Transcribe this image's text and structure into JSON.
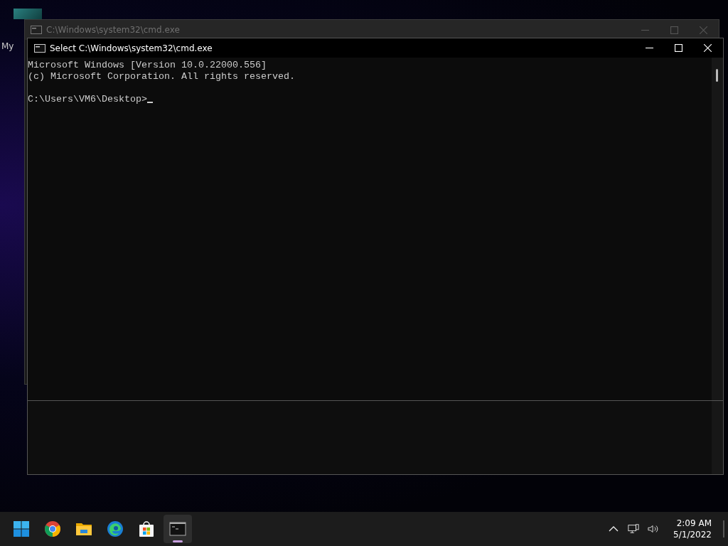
{
  "desktop": {
    "icon_label": "My"
  },
  "background_window": {
    "title": "C:\\Windows\\system32\\cmd.exe"
  },
  "window": {
    "title": "Select C:\\Windows\\system32\\cmd.exe",
    "output": [
      "Microsoft Windows [Version 10.0.22000.556]",
      "(c) Microsoft Corporation. All rights reserved."
    ],
    "prompt": "C:\\Users\\VM6\\Desktop>"
  },
  "taskbar": {
    "apps": [
      {
        "kind": "start",
        "selected": false
      },
      {
        "kind": "chrome",
        "selected": false
      },
      {
        "kind": "folder",
        "selected": false
      },
      {
        "kind": "edge",
        "selected": false
      },
      {
        "kind": "store",
        "selected": false
      },
      {
        "kind": "terminal",
        "selected": true
      }
    ],
    "time": "2:09 AM",
    "date": "5/1/2022"
  }
}
